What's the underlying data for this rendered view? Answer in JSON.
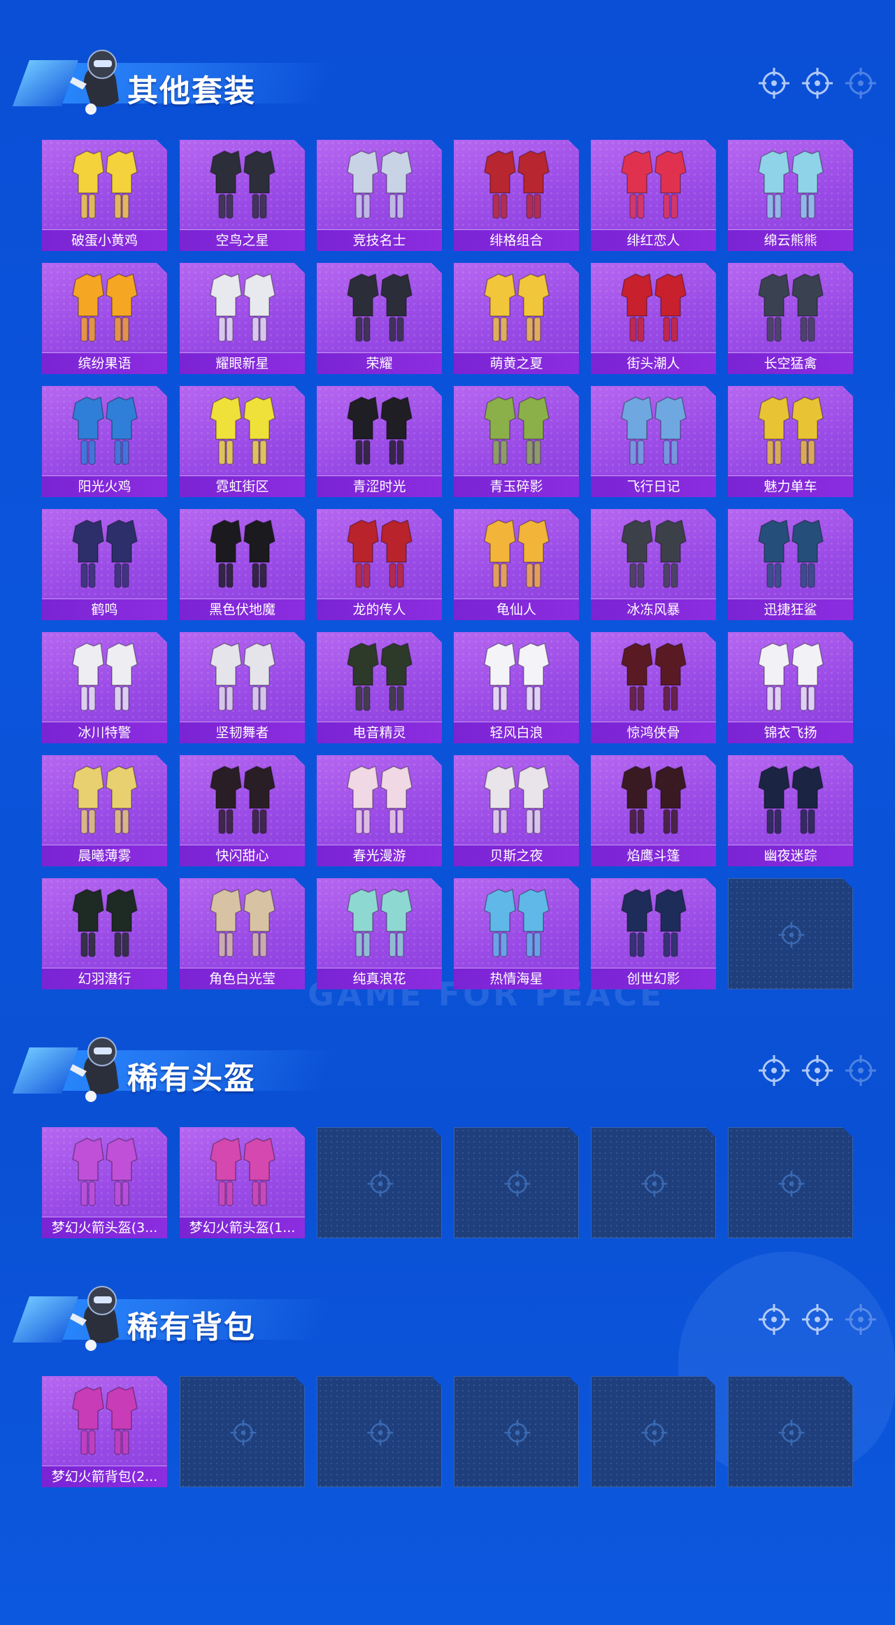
{
  "watermark": "GAME FOR PEACE",
  "colors": {
    "background": "#0a4fd6",
    "card": "#a157ea",
    "label_bar": "#8128d8",
    "empty_card": "#1f3f7c",
    "title": "#ffffff"
  },
  "sections": [
    {
      "title": "其他套装",
      "icons": [
        "crosshair-icon",
        "crosshair-icon",
        "crosshair-icon"
      ],
      "items": [
        {
          "label": "破蛋小黄鸡",
          "art": "#f4d23c"
        },
        {
          "label": "空鸟之星",
          "art": "#2c2f3a"
        },
        {
          "label": "竞技名士",
          "art": "#c9d3e6"
        },
        {
          "label": "绯格组合",
          "art": "#b8262f"
        },
        {
          "label": "绯红恋人",
          "art": "#e0324e"
        },
        {
          "label": "绵云熊熊",
          "art": "#8fd3e8"
        },
        {
          "label": "缤纷果语",
          "art": "#f5a623"
        },
        {
          "label": "耀眼新星",
          "art": "#e8e8ef"
        },
        {
          "label": "荣耀",
          "art": "#2b2e38"
        },
        {
          "label": "萌黄之夏",
          "art": "#f2c63a"
        },
        {
          "label": "街头潮人",
          "art": "#c8202c"
        },
        {
          "label": "长空猛禽",
          "art": "#3a4150"
        },
        {
          "label": "阳光火鸡",
          "art": "#2f7fd8"
        },
        {
          "label": "霓虹街区",
          "art": "#f0e03a"
        },
        {
          "label": "青涩时光",
          "art": "#1e1e24"
        },
        {
          "label": "青玉碎影",
          "art": "#8bb04a"
        },
        {
          "label": "飞行日记",
          "art": "#6fa8e0"
        },
        {
          "label": "魅力单车",
          "art": "#e8c334"
        },
        {
          "label": "鹤鸣",
          "art": "#2c2f6a"
        },
        {
          "label": "黑色伏地魔",
          "art": "#1b1b1f"
        },
        {
          "label": "龙的传人",
          "art": "#b8232c"
        },
        {
          "label": "龟仙人",
          "art": "#f3b43a"
        },
        {
          "label": "冰冻风暴",
          "art": "#3c4048"
        },
        {
          "label": "迅捷狂鲨",
          "art": "#264e7a"
        },
        {
          "label": "冰川特警",
          "art": "#eeeef2"
        },
        {
          "label": "坚韧舞者",
          "art": "#e4e4ea"
        },
        {
          "label": "电音精灵",
          "art": "#2d3a2a"
        },
        {
          "label": "轻风白浪",
          "art": "#f4f4f8"
        },
        {
          "label": "惊鸿侠骨",
          "art": "#5a1a24"
        },
        {
          "label": "锦衣飞扬",
          "art": "#f2f2f6"
        },
        {
          "label": "晨曦薄雾",
          "art": "#e8d070"
        },
        {
          "label": "快闪甜心",
          "art": "#2a1e26"
        },
        {
          "label": "春光漫游",
          "art": "#f0d8e4"
        },
        {
          "label": "贝斯之夜",
          "art": "#e8e4ea"
        },
        {
          "label": "焰鹰斗篷",
          "art": "#3a1a22"
        },
        {
          "label": "幽夜迷踪",
          "art": "#1c2444"
        },
        {
          "label": "幻羽潜行",
          "art": "#1e2a24"
        },
        {
          "label": "角色白光莹",
          "art": "#d8c2a4"
        },
        {
          "label": "纯真浪花",
          "art": "#8ed8d2"
        },
        {
          "label": "热情海星",
          "art": "#5fb8e8"
        },
        {
          "label": "创世幻影",
          "art": "#1e2c5a"
        },
        {
          "empty": true
        }
      ]
    },
    {
      "title": "稀有头盔",
      "icons": [
        "crosshair-icon",
        "crosshair-icon",
        "crosshair-icon"
      ],
      "items": [
        {
          "label": "梦幻火箭头盔(3...",
          "art": "#c050d8"
        },
        {
          "label": "梦幻火箭头盔(1...",
          "art": "#d448b0"
        },
        {
          "empty": true
        },
        {
          "empty": true
        },
        {
          "empty": true
        },
        {
          "empty": true
        }
      ]
    },
    {
      "title": "稀有背包",
      "icons": [
        "crosshair-icon",
        "crosshair-icon",
        "crosshair-icon"
      ],
      "items": [
        {
          "label": "梦幻火箭背包(2...",
          "art": "#c83cb8"
        },
        {
          "empty": true
        },
        {
          "empty": true
        },
        {
          "empty": true
        },
        {
          "empty": true
        },
        {
          "empty": true
        }
      ]
    }
  ]
}
